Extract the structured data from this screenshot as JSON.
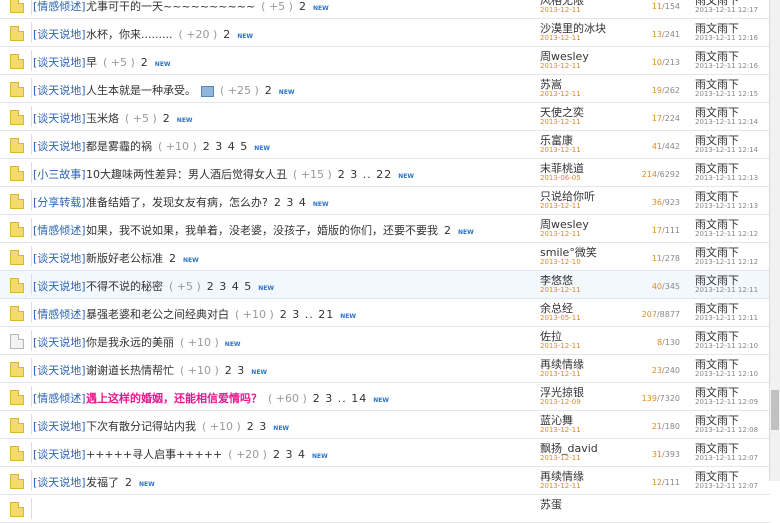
{
  "new_label": "NEW",
  "rows": [
    {
      "cat": "[情感倾述]",
      "title": "尤事可干的一天~~~~~~~~~~",
      "count": "( +5 )",
      "pages": "2",
      "author": "风格无限",
      "pdate": "2013-12-11",
      "rep_a": "11",
      "rep_b": "/154",
      "last": "雨文雨下",
      "ldate": "2013-12-11 12:17",
      "icon": "folder"
    },
    {
      "cat": "[谈天说地]",
      "title": "水杯，你来.........",
      "count": "( +20 )",
      "pages": "2",
      "author": "沙漠里的冰块",
      "pdate": "2013-12-11",
      "rep_a": "13",
      "rep_b": "/241",
      "last": "雨文雨下",
      "ldate": "2013-12-11 12:16",
      "icon": "folder"
    },
    {
      "cat": "[谈天说地]",
      "title": "早",
      "count": "( +5 )",
      "pages": "2",
      "author": "周wesley",
      "pdate": "2013-12-11",
      "rep_a": "10",
      "rep_b": "/213",
      "last": "雨文雨下",
      "ldate": "2013-12-11 12:16",
      "icon": "folder"
    },
    {
      "cat": "[谈天说地]",
      "title": "人生本就是一种承受。",
      "count": "( +25 )",
      "pages": "2",
      "author": "苏嵩",
      "pdate": "2013-12-11",
      "rep_a": "19",
      "rep_b": "/262",
      "last": "雨文雨下",
      "ldate": "2013-12-11 12:15",
      "icon": "folder",
      "img": true
    },
    {
      "cat": "[谈天说地]",
      "title": "玉米烙",
      "count": "( +5 )",
      "pages": "2",
      "author": "天使之奕",
      "pdate": "2013-12-11",
      "rep_a": "17",
      "rep_b": "/224",
      "last": "雨文雨下",
      "ldate": "2013-12-11 12:14",
      "icon": "folder"
    },
    {
      "cat": "[谈天说地]",
      "title": "都是雾霾的祸",
      "count": "( +10 )",
      "pages": "2 3 4 5",
      "author": "乐富康",
      "pdate": "2013-12-11",
      "rep_a": "41",
      "rep_b": "/442",
      "last": "雨文雨下",
      "ldate": "2013-12-11 12:14",
      "icon": "folder"
    },
    {
      "cat": "[小三故事]",
      "title": "10大趣味两性差异：男人酒后觉得女人丑",
      "count": "( +15 )",
      "pages": "2 3 .. 22",
      "author": "末菲桃道",
      "pdate": "2013-06-05",
      "rep_a": "214",
      "rep_b": "/6292",
      "last": "雨文雨下",
      "ldate": "2013-12-11 12:13",
      "icon": "folder"
    },
    {
      "cat": "[分享转载]",
      "title": "准备结婚了，发现女友有病，怎么办?",
      "count": "",
      "pages": "2 3 4",
      "author": "只说给你听",
      "pdate": "2013-12-11",
      "rep_a": "36",
      "rep_b": "/923",
      "last": "雨文雨下",
      "ldate": "2013-12-11 12:13",
      "icon": "folder"
    },
    {
      "cat": "[情感倾述]",
      "title": "如果，我不说如果，我单着，没老婆，没孩子，婚版的你们，还要不要我",
      "count": "",
      "pages": "2",
      "author": "周wesley",
      "pdate": "2013-12-11",
      "rep_a": "17",
      "rep_b": "/111",
      "last": "雨文雨下",
      "ldate": "2013-12-11 12:12",
      "icon": "folder"
    },
    {
      "cat": "[谈天说地]",
      "title": "新版好老公标准",
      "count": "",
      "pages": "2",
      "author": "smile°微笑",
      "pdate": "2013-12-10",
      "rep_a": "11",
      "rep_b": "/278",
      "last": "雨文雨下",
      "ldate": "2013-12-11 12:12",
      "icon": "folder"
    },
    {
      "cat": "[谈天说地]",
      "title": "不得不说的秘密",
      "count": "( +5 )",
      "pages": "2 3 4 5",
      "author": "李悠悠",
      "pdate": "2013-12-11",
      "rep_a": "40",
      "rep_b": "/345",
      "last": "雨文雨下",
      "ldate": "2013-12-11 12:11",
      "icon": "folder",
      "hl": true
    },
    {
      "cat": "[情感倾述]",
      "title": "暴强老婆和老公之间经典对白",
      "count": "( +10 )",
      "pages": "2 3 .. 21",
      "author": "余总经",
      "pdate": "2013-05-11",
      "rep_a": "207",
      "rep_b": "/8877",
      "last": "雨文雨下",
      "ldate": "2013-12-11 12:11",
      "icon": "folder"
    },
    {
      "cat": "[谈天说地]",
      "title": "你是我永远的美丽",
      "count": "( +10 )",
      "pages": "",
      "author": "佐拉",
      "pdate": "2013-12-11",
      "rep_a": "8",
      "rep_b": "/130",
      "last": "雨文雨下",
      "ldate": "2013-12-11 12:10",
      "icon": "doc"
    },
    {
      "cat": "[谈天说地]",
      "title": "谢谢道长热情帮忙",
      "count": "( +10 )",
      "pages": "2 3",
      "author": "再续情缘",
      "pdate": "2013-12-11",
      "rep_a": "23",
      "rep_b": "/240",
      "last": "雨文雨下",
      "ldate": "2013-12-11 12:10",
      "icon": "folder"
    },
    {
      "cat": "[情感倾述]",
      "title": "遇上这样的婚姻，还能相信爱情吗？",
      "count": "( +60 )",
      "pages": "2 3 .. 14",
      "author": "浮光掠银",
      "pdate": "2013-12-09",
      "rep_a": "139",
      "rep_b": "/7320",
      "last": "雨文雨下",
      "ldate": "2013-12-11 12:09",
      "icon": "folder",
      "hot": true
    },
    {
      "cat": "[谈天说地]",
      "title": "下次有散分记得站内我",
      "count": "( +10 )",
      "pages": "2 3",
      "author": "蓝沁舞",
      "pdate": "2013-12-11",
      "rep_a": "21",
      "rep_b": "/180",
      "last": "雨文雨下",
      "ldate": "2013-12-11 12:08",
      "icon": "folder"
    },
    {
      "cat": "[谈天说地]",
      "title": "+++++寻人启事+++++",
      "count": "( +20 )",
      "pages": "2 3 4",
      "author": "飘扬_david",
      "pdate": "2013-12-11",
      "rep_a": "31",
      "rep_b": "/393",
      "last": "雨文雨下",
      "ldate": "2013-12-11 12:07",
      "icon": "folder"
    },
    {
      "cat": "[谈天说地]",
      "title": "发福了",
      "count": "",
      "pages": "2",
      "author": "再续情缘",
      "pdate": "2013-12-11",
      "rep_a": "12",
      "rep_b": "/111",
      "last": "雨文雨下",
      "ldate": "2013-12-11 12:07",
      "icon": "folder"
    },
    {
      "cat": "",
      "title": "",
      "count": "",
      "pages": "",
      "author": "苏蛋",
      "pdate": "",
      "rep_a": "",
      "rep_b": "",
      "last": "",
      "ldate": "",
      "icon": "folder"
    }
  ]
}
